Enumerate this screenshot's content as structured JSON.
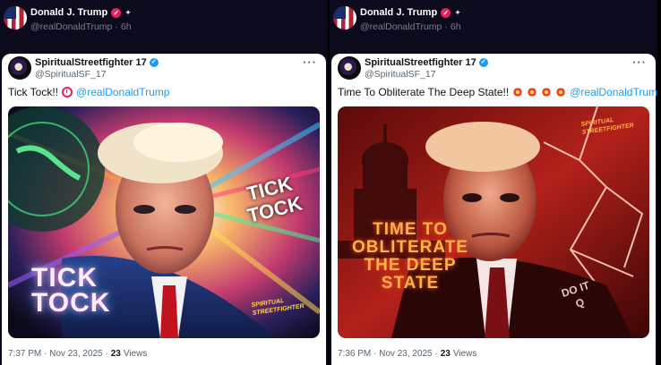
{
  "panels": [
    {
      "outer": {
        "name": "Donald J. Trump",
        "handle": "@realDonaldTrump",
        "separator": "·",
        "time": "6h"
      },
      "tweet": {
        "name": "SpiritualStreetfighter 17",
        "handle": "@SpiritualSF_17",
        "text": "Tick Tock!!",
        "mention": "@realDonaldTrump",
        "emoji_icons": [
          "alarm-clock-icon"
        ],
        "media_text_primary": [
          "TICK",
          "TOCK"
        ],
        "media_text_secondary": [
          "TICK",
          "TOCK"
        ],
        "media_logo": [
          "SPIRITUAL",
          "STREETFIGHTER"
        ],
        "timestamp": "7:37 PM · Nov 23, 2025 ·",
        "views_count": "23",
        "views_label": "Views"
      }
    },
    {
      "outer": {
        "name": "Donald J. Trump",
        "handle": "@realDonaldTrump",
        "separator": "·",
        "time": "6h"
      },
      "tweet": {
        "name": "SpiritualStreetfighter 17",
        "handle": "@SpiritualSF_17",
        "text": "Time To Obliterate The Deep State!!",
        "mention": "@realDonaldTrump",
        "emoji_icons": [
          "collision-icon",
          "collision-icon",
          "collision-icon",
          "collision-icon"
        ],
        "media_text_primary": [
          "TIME TO",
          "OBLITERATE",
          "THE DEEP",
          "STATE"
        ],
        "media_text_secondary": [
          "DO IT",
          "Q"
        ],
        "media_logo": [
          "SPIRITUAL",
          "STREETFIGHTER"
        ],
        "timestamp": "7:36 PM · Nov 23, 2025 ·",
        "views_count": "23",
        "views_label": "Views"
      }
    }
  ],
  "colors": {
    "background": "#0b0b1d",
    "verified_pink": "#e0245e",
    "verified_blue": "#1d9bf0",
    "mention": "#1d9bf0"
  }
}
